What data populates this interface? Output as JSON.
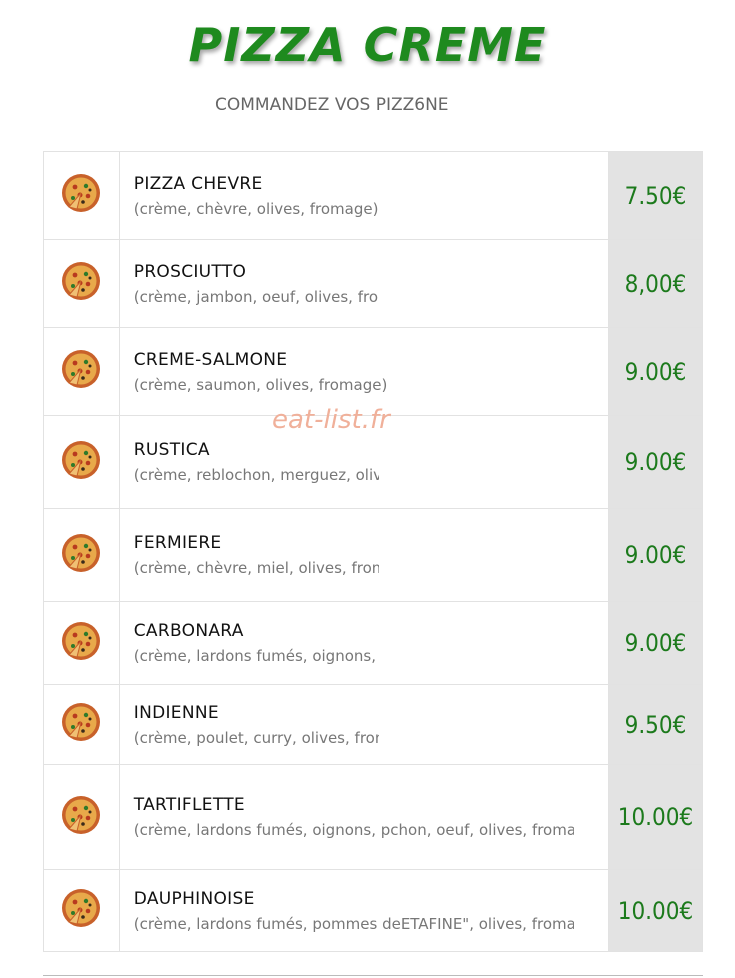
{
  "header": {
    "title": "PIZZA CREME",
    "subtitle": "COMMANDEZ VOS PIZZ6NE"
  },
  "watermark": "eat-list.fr",
  "items": [
    {
      "name": "PIZZA CHEVRE",
      "desc": "(crème, chèvre, olives, fromage)",
      "price": "7.50€"
    },
    {
      "name": "PROSCIUTTO",
      "desc": "(crème, jambon, oeuf, olives, froma",
      "price": "8,00€"
    },
    {
      "name": "CREME-SALMONE",
      "desc": "(crème, saumon, olives, fromage)",
      "price": "9.00€"
    },
    {
      "name": "RUSTICA",
      "desc": "(crème, reblochon, merguez, olives",
      "price": "9.00€"
    },
    {
      "name": "FERMIERE",
      "desc": "(crème, chèvre, miel, olives, froma",
      "price": "9.00€"
    },
    {
      "name": "CARBONARA",
      "desc": "(crème, lardons fumés, oignons, oe",
      "price": "9.00€"
    },
    {
      "name": "INDIENNE",
      "desc": "(crème, poulet, curry, olives, from",
      "price": "9.50€"
    },
    {
      "name": "TARTIFLETTE",
      "desc": "(crème, lardons fumés, oignons, pchon, oeuf, olives, fromage)",
      "price": "10.00€"
    },
    {
      "name": "DAUPHINOISE",
      "desc": "(crème, lardons fumés, pommes deETAFINE\", olives, fromage",
      "price": "10.00€"
    }
  ],
  "colors": {
    "title": "#1e8a1e",
    "price": "#1c7a1c",
    "price_bg": "#e3e3e3"
  },
  "icon": "pizza-icon"
}
